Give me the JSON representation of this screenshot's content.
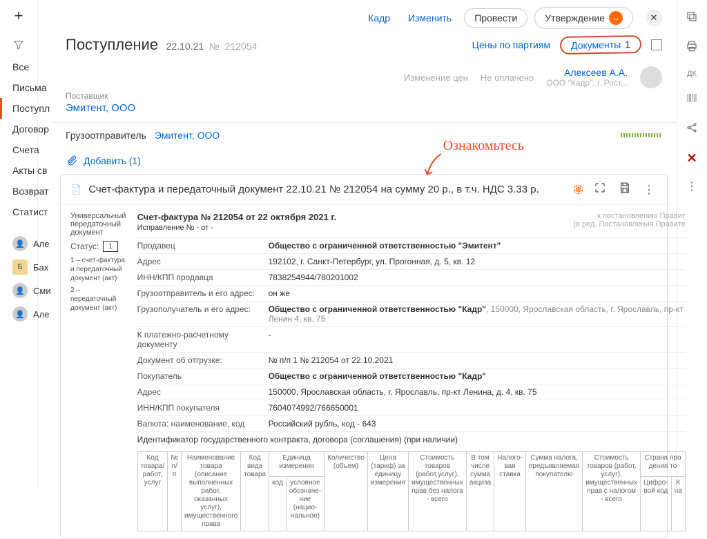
{
  "leftbar": {
    "plus": "+"
  },
  "sidebar": {
    "items": [
      "Все",
      "Письма",
      "Поступл",
      "Договор",
      "Счета",
      "Акты св",
      "Возврат",
      "Статист"
    ]
  },
  "users": [
    {
      "label": "Але"
    },
    {
      "label": "Бах",
      "initial": "Б"
    },
    {
      "label": "Сми"
    },
    {
      "label": "Але"
    }
  ],
  "topbar": {
    "kadr": "Кадр",
    "edit": "Изменить",
    "execute": "Провести",
    "approve": "Утверждение"
  },
  "header": {
    "title": "Поступление",
    "date": "22.10.21",
    "num_prefix": "№ ",
    "num": "212054",
    "prices": "Цены по партиям",
    "documents": "Документы",
    "doc_count": "1"
  },
  "meta": {
    "price_change": "Изменение цен",
    "unpaid": "Не оплачено",
    "person_name": "Алексеев А.А.",
    "person_co": "ООО \"Кадр\", г. Рост..."
  },
  "supplier": {
    "label": "Поставщик",
    "value": "Эмитент, ООО"
  },
  "shipper": {
    "label": "Грузоотправитель",
    "value": "Эмитент, ООО"
  },
  "add": {
    "label": "Добавить (1)"
  },
  "annotation": "Ознакомьтесь",
  "doc": {
    "title": "Счет-фактура и передаточный документ 22.10.21 № 212054 на сумму 20 р., в т.ч. НДС 3.33 р.",
    "upd": "Универсальный передаточный документ",
    "status_label": "Статус:",
    "status_val": "1",
    "note1": "1 – счет-фактура и передаточный документ (акт)",
    "note2": "2 – передаточный документ (акт)",
    "heading": "Счет-фактура № 212054 от 22 октября 2021 г.",
    "correction": "Исправление № - от -",
    "decree1": "к постановлению Правит",
    "decree2": "(в ред. Постановления Правите",
    "rows": [
      {
        "k": "Продавец",
        "v": "Общество с ограниченной ответственностью \"Эмитент\"",
        "bold": true
      },
      {
        "k": "Адрес",
        "v": "192102, г. Санкт-Петербург, ул. Прогонная, д. 5, кв. 12"
      },
      {
        "k": "ИНН/КПП продавца",
        "v": "7838254944/780201002"
      },
      {
        "k": "Грузоотправитель и его адрес:",
        "v": "он же"
      },
      {
        "k": "Грузополучатель и его адрес:",
        "v": "Общество с ограниченной ответственностью \"Кадр\"",
        "suffix": ", 150000, Ярославская область, г. Ярославль, пр-кт Ленин 4, кв. 75",
        "bold": true
      },
      {
        "k": "К платежно-расчетному документу",
        "v": "-"
      },
      {
        "k": "Документ об отгрузке:",
        "v": "№ п/п 1 № 212054 от 22.10.2021"
      },
      {
        "k": "Покупатель",
        "v": "Общество с ограниченной ответственностью \"Кадр\"",
        "bold": true
      },
      {
        "k": "Адрес",
        "v": "150000, Ярославская область, г. Ярославль, пр-кт Ленина, д. 4, кв. 75"
      },
      {
        "k": "ИНН/КПП покупателя",
        "v": "7604074992/766650001"
      },
      {
        "k": "Валюта: наименование, код",
        "v": "Российский рубль, код - 643"
      }
    ],
    "contract_id": "Идентификатор государственного контракта, договора (соглашения) (при наличии)"
  },
  "table_headers": {
    "c1": "Код товара/ работ, услуг",
    "c2": "№ п/п",
    "c3": "Наименование товара (описание выполненных работ, оказанных услуг), имущественного права",
    "c4": "Код вида товара",
    "c5": "Единица измерения",
    "c5a": "код",
    "c5b": "условное обозначе-ние (нацио-нальное)",
    "c6": "Количество (объем)",
    "c7": "Цена (тариф) за единицу измерения",
    "c8": "Стоимость товаров (работ,услуг), имущественных прав без налога - всего",
    "c9": "В том числе сумма акциза",
    "c10": "Налого-вая ставка",
    "c11": "Сумма налога, предъявляемая покупателю",
    "c12": "Стоимость товаров (работ, услуг), имущественных прав с налогом - всего",
    "c13": "Страна про дения то",
    "c13a": "Цифро-вой код",
    "c13b": "К на"
  },
  "rightbar": {
    "dk": "ДК"
  }
}
